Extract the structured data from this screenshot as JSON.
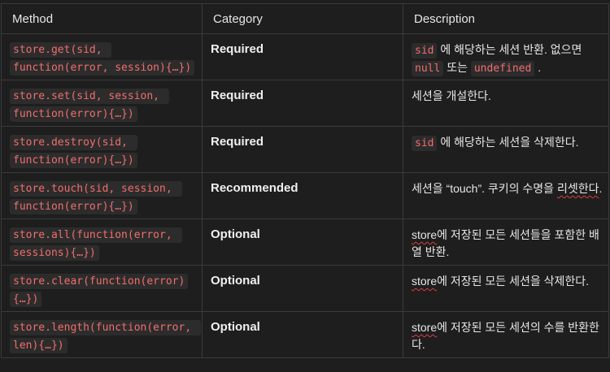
{
  "headers": {
    "method": "Method",
    "category": "Category",
    "description": "Description"
  },
  "rows": [
    {
      "method": "store.get(sid, function(error, session){…})",
      "category": "Required",
      "desc": [
        {
          "code": "sid"
        },
        {
          "text": " 에 해당하는 세션 반환. 없으면 "
        },
        {
          "code": "null"
        },
        {
          "text": " 또는 "
        },
        {
          "code": "undefined"
        },
        {
          "text": " ."
        }
      ]
    },
    {
      "method": "store.set(sid, session, function(error){…})",
      "category": "Required",
      "desc": [
        {
          "text": "세션을 개설한다."
        }
      ]
    },
    {
      "method": "store.destroy(sid, function(error){…})",
      "category": "Required",
      "desc": [
        {
          "code": "sid"
        },
        {
          "text": " 에 해당하는 세션을 삭제한다."
        }
      ]
    },
    {
      "method": "store.touch(sid, session, function(error){…})",
      "category": "Recommended",
      "desc": [
        {
          "text": "세션을 “touch”. 쿠키의 수명을 "
        },
        {
          "sq": "리셋한다"
        },
        {
          "text": "."
        }
      ]
    },
    {
      "method": "store.all(function(error, sessions){…})",
      "category": "Optional",
      "desc": [
        {
          "sq": "store"
        },
        {
          "text": "에 저장된 모든 세션들을 포함한 배열 반환."
        }
      ]
    },
    {
      "method": "store.clear(function(error){…})",
      "category": "Optional",
      "desc": [
        {
          "sq": "store"
        },
        {
          "text": "에 저장된 모든 세션을 삭제한다."
        }
      ]
    },
    {
      "method": "store.length(function(error, len){…})",
      "category": "Optional",
      "desc": [
        {
          "sq": "store"
        },
        {
          "text": "에 저장된 모든 세션의 수를 반환한다."
        }
      ]
    }
  ]
}
